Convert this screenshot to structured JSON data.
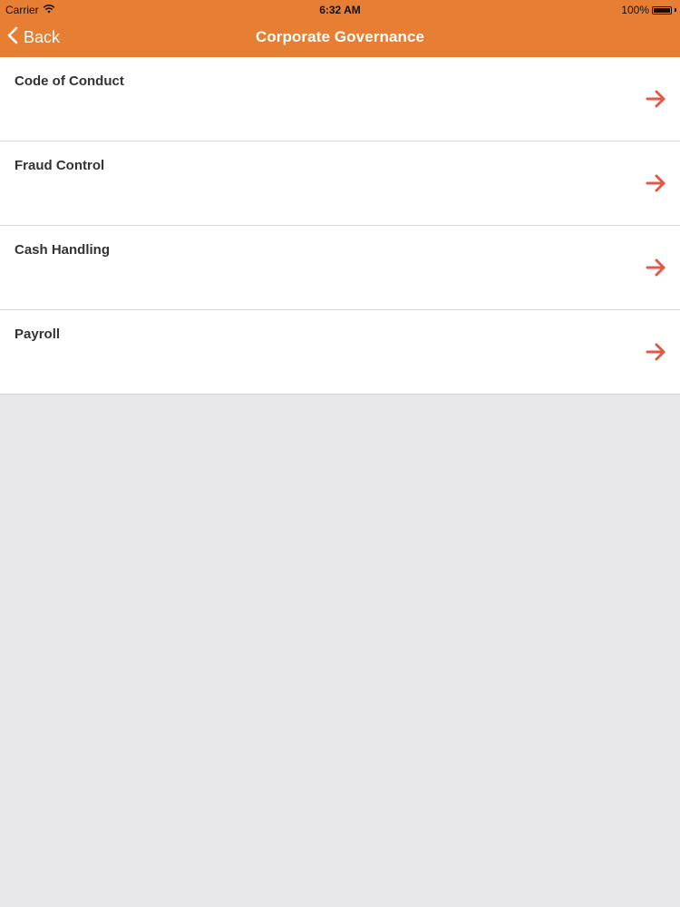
{
  "status_bar": {
    "carrier": "Carrier",
    "time": "6:32 AM",
    "battery_percent": "100%",
    "battery_level": 1.0,
    "wifi_icon": "wifi-icon",
    "battery_icon": "battery-icon"
  },
  "nav": {
    "back_label": "Back",
    "back_icon": "chevron-left-icon",
    "title": "Corporate Governance"
  },
  "list": {
    "items": [
      {
        "label": "Code of Conduct",
        "icon": "arrow-right-icon"
      },
      {
        "label": "Fraud Control",
        "icon": "arrow-right-icon"
      },
      {
        "label": "Cash Handling",
        "icon": "arrow-right-icon"
      },
      {
        "label": "Payroll",
        "icon": "arrow-right-icon"
      }
    ]
  },
  "colors": {
    "nav_background": "#e67e33",
    "arrow": "#e25a45",
    "page_background": "#e8e7e9",
    "list_background": "#ffffff",
    "label_text": "#333333"
  }
}
